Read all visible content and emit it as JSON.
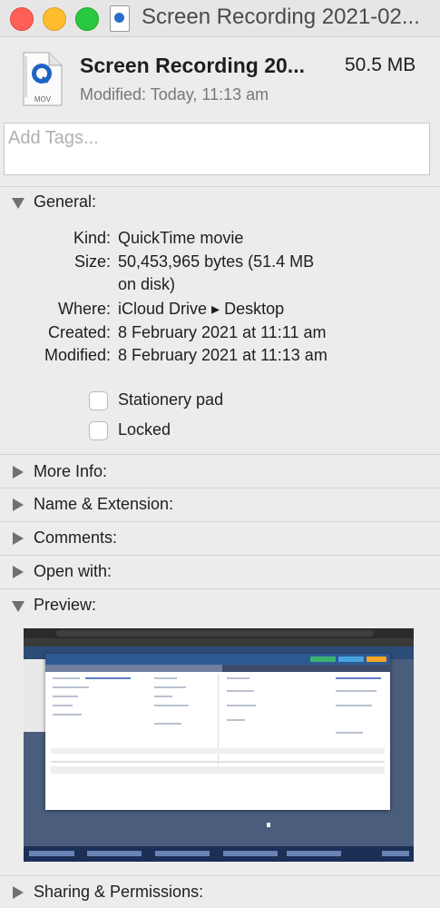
{
  "window": {
    "title": "Screen Recording 2021-02..."
  },
  "file": {
    "name": "Screen Recording 20...",
    "size": "50.5 MB",
    "modified_line": "Modified: Today, 11:13 am",
    "icon_label": "MOV"
  },
  "tags": {
    "placeholder": "Add Tags..."
  },
  "general": {
    "label": "General:",
    "rows": [
      {
        "key": "Kind:",
        "value": "QuickTime movie"
      },
      {
        "key": "Size:",
        "value": "50,453,965 bytes (51.4 MB",
        "value2": "on disk)"
      },
      {
        "key": "Where:",
        "value": "iCloud Drive ▸ Desktop"
      },
      {
        "key": "Created:",
        "value": "8 February 2021 at 11:11 am"
      },
      {
        "key": "Modified:",
        "value": "8 February 2021 at 11:13 am"
      }
    ],
    "stationery_label": "Stationery pad",
    "locked_label": "Locked"
  },
  "sections": {
    "more_info": "More Info:",
    "name_extension": "Name & Extension:",
    "comments": "Comments:",
    "open_with": "Open with:",
    "preview": "Preview:",
    "sharing": "Sharing & Permissions:"
  },
  "icons": {
    "close": "close-light",
    "minimize": "minimize-light",
    "zoom": "zoom-light",
    "file": "quicktime-mov-icon",
    "disclosure_open": "triangle-down-icon",
    "disclosure_closed": "triangle-right-icon"
  },
  "colors": {
    "close": "#fe5f57",
    "minimize": "#febc2e",
    "zoom": "#28c840",
    "window_bg": "#ececec"
  },
  "checkboxes": {
    "stationery_checked": false,
    "locked_checked": false
  }
}
